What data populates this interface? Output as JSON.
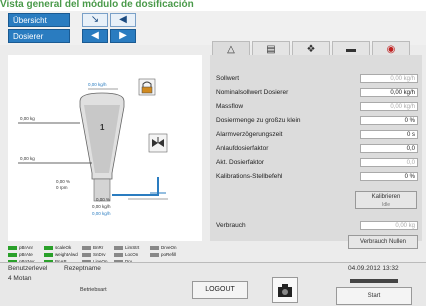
{
  "caption": "Vista general del módulo de dosificación",
  "nav": {
    "overview_label": "Übersicht",
    "dosing_label": "Dosierer"
  },
  "diagram": {
    "weight_top": "0,00 kg/h",
    "weight_left": "0,00 kg",
    "hopper_number": "1",
    "weight_mid": "0,00 kg",
    "percent_line1": "0,00 %",
    "percent_line2": "0 rpm",
    "weight_outlet": "0,00 %",
    "weight_bottom1": "0,00 kg/h",
    "weight_bottom2": "0,00 kg/h"
  },
  "params": [
    {
      "label": "Sollwert",
      "value": "0,00 kg/h",
      "gray": true
    },
    {
      "label": "Nominalsollwert Dosierer",
      "value": "0,00 kg/h",
      "gray": false
    },
    {
      "label": "Massflow",
      "value": "0,00 kg/h",
      "gray": true
    },
    {
      "label": "Dosiermenge zu großzu klein",
      "value": "0 %",
      "gray": false
    },
    {
      "label": "Alarmverzögerungszeit",
      "value": "0 s",
      "gray": false
    },
    {
      "label": "Anlaufdosierfaktor",
      "value": "0,0",
      "gray": false
    },
    {
      "label": "Akt. Dosierfaktor",
      "value": "0,0",
      "gray": true
    },
    {
      "label": "Kalibrations-Stellbefehl",
      "value": "0 %",
      "gray": false
    }
  ],
  "calibrate_button": {
    "label": "Kalibrieren",
    "sub": "Idle"
  },
  "consumption": {
    "label": "Verbrauch",
    "value": "0,00 kg"
  },
  "reset_consumption_label": "Verbrauch Nullen",
  "legend": [
    {
      "label": "pBrAnr",
      "color": "#2aa02a"
    },
    {
      "label": "scaleOk",
      "color": "#2aa02a"
    },
    {
      "label": "BnRr",
      "color": "#888888"
    },
    {
      "label": "LimStrt",
      "color": "#888888"
    },
    {
      "label": "pBrAte",
      "color": "#2aa02a"
    },
    {
      "label": "weightAlwd",
      "color": "#2aa02a"
    },
    {
      "label": "SnDrv",
      "color": "#888888"
    },
    {
      "label": "LocOn",
      "color": "#888888"
    },
    {
      "label": "DrveOn",
      "color": "#888888"
    },
    {
      "label": "pBrrNur",
      "color": "#2aa02a"
    },
    {
      "label": "BnAP",
      "color": "#2aa02a"
    },
    {
      "label": "LineOn",
      "color": "#888888"
    },
    {
      "label": "Drv",
      "color": "#888888"
    },
    {
      "label": "poRefill",
      "color": "#888888"
    }
  ],
  "footer": {
    "user_level_label": "Benutzerlevel",
    "user_level_value": "4  Motan",
    "recipe_label": "Rezeptname",
    "mode_label": "Betriebsart",
    "logout_label": "LOGOUT",
    "datetime": "04.09.2012 13:32",
    "start_label": "Start"
  }
}
